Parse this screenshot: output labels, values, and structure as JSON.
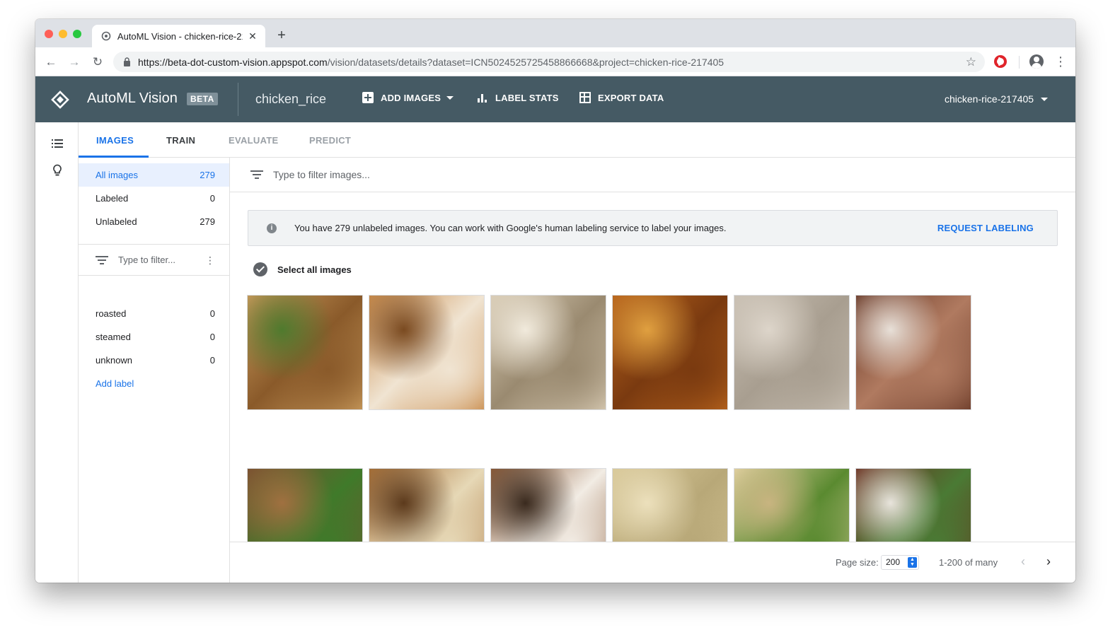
{
  "browser": {
    "tab_title": "AutoML Vision - chicken-rice-217405",
    "new_tab": "+",
    "url_host": "https://beta-dot-custom-vision.appspot.com",
    "url_rest": "/vision/datasets/details?dataset=ICN5024525725458866668&project=chicken-rice-217405"
  },
  "header": {
    "app_name": "AutoML Vision",
    "badge": "BETA",
    "dataset": "chicken_rice",
    "add_images": "ADD IMAGES",
    "label_stats": "LABEL STATS",
    "export_data": "EXPORT DATA",
    "project": "chicken-rice-217405"
  },
  "tabs": [
    {
      "label": "IMAGES",
      "state": "active"
    },
    {
      "label": "TRAIN",
      "state": "normal"
    },
    {
      "label": "EVALUATE",
      "state": "disabled"
    },
    {
      "label": "PREDICT",
      "state": "disabled"
    }
  ],
  "sidebar": {
    "groups": [
      {
        "label": "All images",
        "count": "279"
      },
      {
        "label": "Labeled",
        "count": "0"
      },
      {
        "label": "Unlabeled",
        "count": "279"
      }
    ],
    "filter_placeholder": "Type to filter...",
    "labels": [
      {
        "label": "roasted",
        "count": "0"
      },
      {
        "label": "steamed",
        "count": "0"
      },
      {
        "label": "unknown",
        "count": "0"
      }
    ],
    "add_label": "Add label"
  },
  "main": {
    "filter_placeholder": "Type to filter images...",
    "banner_text": "You have 279 unlabeled images. You can work with Google's human labeling service to label your images.",
    "banner_action": "REQUEST LABELING",
    "select_all": "Select all images",
    "images": [
      {
        "name": "roasted-chicken-cilantro",
        "colors": [
          "#c89a5c",
          "#8a5a2a",
          "#4f7a2e"
        ]
      },
      {
        "name": "roasted-chicken-slices",
        "colors": [
          "#c98c4c",
          "#f0e4d2",
          "#7a4a20"
        ]
      },
      {
        "name": "steamed-chicken-rice",
        "colors": [
          "#d8cbb4",
          "#9a8a70",
          "#f1eadc"
        ]
      },
      {
        "name": "glazed-chicken-sauce",
        "colors": [
          "#b8641c",
          "#7a3a10",
          "#e0a040"
        ]
      },
      {
        "name": "steamed-chicken-plain",
        "colors": [
          "#c8bfb2",
          "#a89e90",
          "#ddd5ca"
        ]
      },
      {
        "name": "soy-chicken-rice",
        "colors": [
          "#6a3a28",
          "#b07a60",
          "#e8e0d8"
        ]
      },
      {
        "name": "roasted-chicken-greens",
        "colors": [
          "#7a5030",
          "#3f7a2a",
          "#a07040"
        ]
      },
      {
        "name": "roasted-chicken-rice",
        "colors": [
          "#a87038",
          "#e6d8b6",
          "#5c3a1c"
        ]
      },
      {
        "name": "roasted-chicken-chopped",
        "colors": [
          "#8a5a38",
          "#f2ece4",
          "#3a2a1e"
        ]
      },
      {
        "name": "steamed-chicken-yellow",
        "colors": [
          "#d8c898",
          "#b8a878",
          "#ece0bc"
        ]
      },
      {
        "name": "steamed-chicken-herbs",
        "colors": [
          "#e0d0a0",
          "#5a8a30",
          "#c8b480"
        ]
      },
      {
        "name": "roasted-chicken-salad",
        "colors": [
          "#6a3020",
          "#4a7a34",
          "#e8e4dc"
        ]
      }
    ]
  },
  "pagination": {
    "page_size_label": "Page size:",
    "page_size": "200",
    "range": "1-200 of many"
  }
}
